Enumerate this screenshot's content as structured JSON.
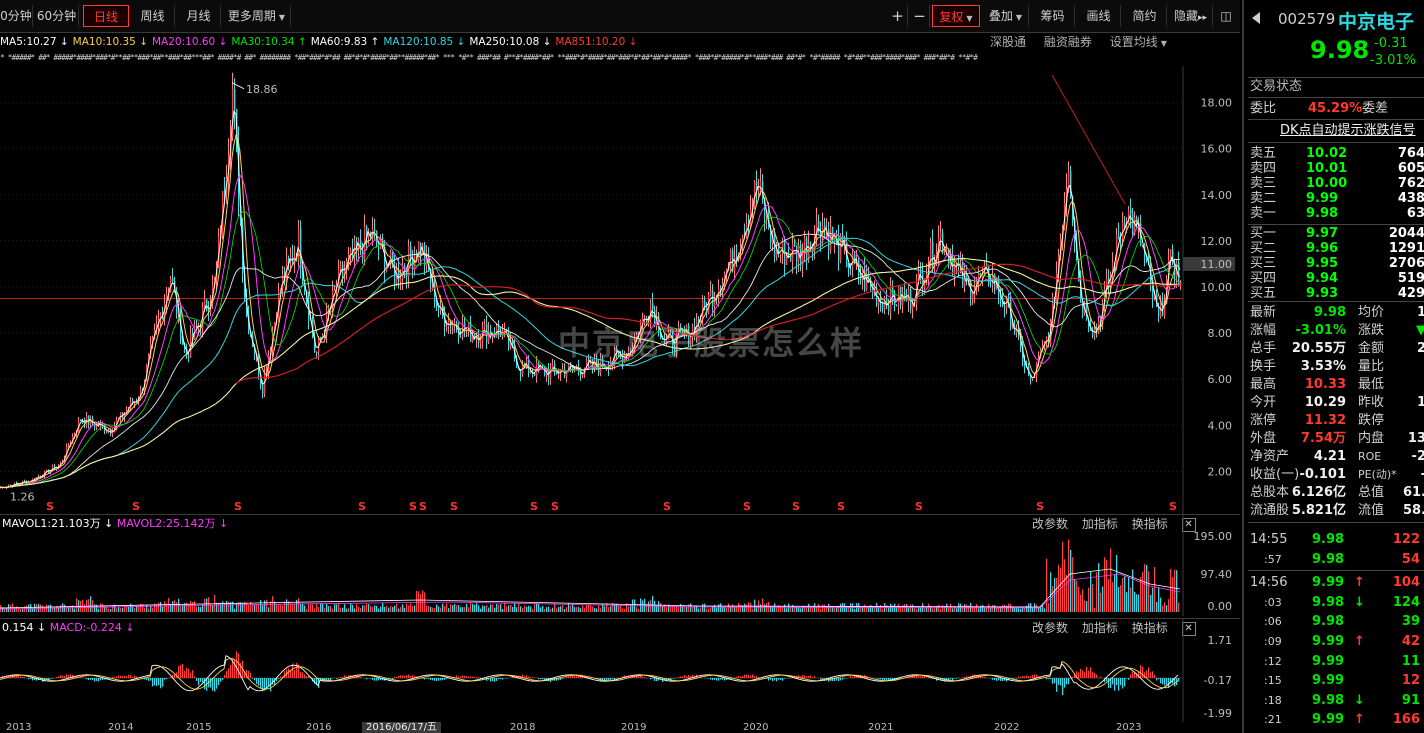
{
  "toolbar": {
    "tabs": [
      {
        "label": "0分钟",
        "active": false
      },
      {
        "label": "60分钟",
        "active": false
      },
      {
        "label": "日线",
        "active": true
      },
      {
        "label": "周线",
        "active": false
      },
      {
        "label": "月线",
        "active": false
      },
      {
        "label": "更多周期",
        "active": false,
        "dropdown": true
      }
    ],
    "zoom_in": "+",
    "zoom_out": "−",
    "fuquan": "复权",
    "overlay": "叠加",
    "chips": "筹码",
    "draw": "画线",
    "simple": "简约",
    "hide_indicators": "隐藏",
    "more": "▸▸",
    "expand": "◫"
  },
  "ma_legend": [
    {
      "label": "MA5:10.27",
      "arrow": "↓",
      "color": "#ffffff"
    },
    {
      "label": "MA10:10.35",
      "arrow": "↓",
      "color": "#ffd24a"
    },
    {
      "label": "MA20:10.60",
      "arrow": "↓",
      "color": "#ff3bff"
    },
    {
      "label": "MA30:10.34",
      "arrow": "↑",
      "color": "#00e600"
    },
    {
      "label": "MA60:9.83",
      "arrow": "↑",
      "color": "#ffffff"
    },
    {
      "label": "MA120:10.85",
      "arrow": "↓",
      "color": "#2fd8e0"
    },
    {
      "label": "MA250:10.08",
      "arrow": "↓",
      "color": "#ffffff"
    },
    {
      "label": "MA851:10.20",
      "arrow": "↓",
      "color": "#ff3b30"
    }
  ],
  "ma_tools": [
    "深股通",
    "融资融券",
    "设置均线"
  ],
  "star_row": "* *#####*  ##*  #####*####*###*#**##**###*##**###*##***##* ####*# ##*  ######## *##*###*#*##  ##*#*#*####*##**#####*##* *** *#** ###*##  #**#*####*##*  **###*#*####*##*###*#*##*##*#*####* *###*#*#####*#**###*###  ##*#* *#*#####  *#*##**###*####*###* ###*##*# **#*#",
  "price_axis": [
    "18.00",
    "16.00",
    "14.00",
    "12.00",
    "10.00",
    "8.00",
    "6.00",
    "4.00",
    "2.00"
  ],
  "current_price_tag": "11.00",
  "peak_label": "18.86",
  "low_label": "1.26",
  "signal_mark": "S",
  "watermark": "中京电子股票怎么样",
  "vol_pane": {
    "legend": [
      {
        "label": "MAVOL1:21.103万",
        "arrow": "↓",
        "color": "#ffffff"
      },
      {
        "label": "MAVOL2:25.142万",
        "arrow": "↓",
        "color": "#ff3bff"
      }
    ],
    "tools": [
      "改参数",
      "加指标",
      "换指标"
    ],
    "axis": [
      "195.00",
      "97.40",
      "0.00"
    ]
  },
  "macd_pane": {
    "legend": [
      {
        "label": "0.154",
        "arrow": "↓",
        "color": "#ffffff"
      },
      {
        "label": "MACD:-0.224",
        "arrow": "↓",
        "color": "#ff3bff"
      }
    ],
    "tools": [
      "改参数",
      "加指标",
      "换指标"
    ],
    "axis": [
      "1.71",
      "-0.17",
      "-1.99"
    ]
  },
  "date_axis": [
    "2013",
    "2014",
    "2015",
    "2016",
    "2018",
    "2019",
    "2020",
    "2021",
    "2022",
    "2023"
  ],
  "crosshair_date": "2016/06/17/五",
  "quote": {
    "code": "002579",
    "name": "中京电子",
    "price": "9.98",
    "change": "-0.31",
    "change_pct": "-3.01%",
    "trade_status_label": "交易状态",
    "weibi_label": "委比",
    "weibi_value": "45.29%",
    "weicha_label": "委差",
    "dk_signal": "DK点自动提示涨跌信号",
    "asks": [
      {
        "label": "卖五",
        "price": "10.02",
        "vol": "764"
      },
      {
        "label": "卖四",
        "price": "10.01",
        "vol": "605"
      },
      {
        "label": "卖三",
        "price": "10.00",
        "vol": "762"
      },
      {
        "label": "卖二",
        "price": "9.99",
        "vol": "438"
      },
      {
        "label": "卖一",
        "price": "9.98",
        "vol": "63"
      }
    ],
    "bids": [
      {
        "label": "买一",
        "price": "9.97",
        "vol": "2044"
      },
      {
        "label": "买二",
        "price": "9.96",
        "vol": "1291"
      },
      {
        "label": "买三",
        "price": "9.95",
        "vol": "2706"
      },
      {
        "label": "买四",
        "price": "9.94",
        "vol": "519"
      },
      {
        "label": "买五",
        "price": "9.93",
        "vol": "429"
      }
    ],
    "stats": [
      {
        "l1": "最新",
        "v1": "9.98",
        "c1": "green",
        "l2": "均价",
        "v2": "1"
      },
      {
        "l1": "涨幅",
        "v1": "-3.01%",
        "c1": "green",
        "l2": "涨跌",
        "v2": "▼"
      },
      {
        "l1": "总手",
        "v1": "20.55万",
        "c1": "white",
        "l2": "金额",
        "v2": "2"
      },
      {
        "l1": "换手",
        "v1": "3.53%",
        "c1": "white",
        "l2": "量比",
        "v2": ""
      },
      {
        "l1": "最高",
        "v1": "10.33",
        "c1": "red",
        "l2": "最低",
        "v2": ""
      },
      {
        "l1": "今开",
        "v1": "10.29",
        "c1": "white",
        "l2": "昨收",
        "v2": "1"
      },
      {
        "l1": "涨停",
        "v1": "11.32",
        "c1": "red",
        "l2": "跌停",
        "v2": ""
      },
      {
        "l1": "外盘",
        "v1": "7.54万",
        "c1": "red",
        "l2": "内盘",
        "v2": "13"
      },
      {
        "l1": "净资产",
        "v1": "4.21",
        "c1": "white",
        "l2": "ROE",
        "v2": "-2"
      },
      {
        "l1": "收益(一)",
        "v1": "-0.101",
        "c1": "white",
        "l2": "PE(动)*",
        "v2": "-"
      },
      {
        "l1": "总股本",
        "v1": "6.126亿",
        "c1": "white",
        "l2": "总值",
        "v2": "61."
      },
      {
        "l1": "流通股",
        "v1": "5.821亿",
        "c1": "white",
        "l2": "流值",
        "v2": "58."
      }
    ],
    "ticks": [
      {
        "time": "14:55",
        "price": "9.98",
        "arrow": "",
        "vol": "122",
        "vcolor": "red"
      },
      {
        "time": ":57",
        "price": "9.98",
        "arrow": "",
        "vol": "54",
        "vcolor": "red"
      },
      {
        "time": "14:56",
        "price": "9.99",
        "arrow": "↑",
        "vol": "104",
        "vcolor": "red"
      },
      {
        "time": ":03",
        "price": "9.98",
        "arrow": "↓",
        "vol": "124",
        "vcolor": "green"
      },
      {
        "time": ":06",
        "price": "9.98",
        "arrow": "",
        "vol": "39",
        "vcolor": "green"
      },
      {
        "time": ":09",
        "price": "9.99",
        "arrow": "↑",
        "vol": "42",
        "vcolor": "red"
      },
      {
        "time": ":12",
        "price": "9.99",
        "arrow": "",
        "vol": "11",
        "vcolor": "green"
      },
      {
        "time": ":15",
        "price": "9.99",
        "arrow": "",
        "vol": "12",
        "vcolor": "red"
      },
      {
        "time": ":18",
        "price": "9.98",
        "arrow": "↓",
        "vol": "91",
        "vcolor": "green"
      },
      {
        "time": ":21",
        "price": "9.99",
        "arrow": "↑",
        "vol": "166",
        "vcolor": "red"
      }
    ]
  },
  "chart_data": {
    "type": "line",
    "title": "",
    "x": [
      "2013",
      "2014",
      "2015",
      "2016",
      "2018",
      "2019",
      "2020",
      "2021",
      "2022",
      "2023"
    ],
    "ylim": [
      0.5,
      19.5
    ],
    "series": [
      {
        "name": "MA5",
        "values": [
          1.3,
          4.2,
          16.5,
          9.8,
          6.6,
          8.4,
          13.8,
          10.5,
          6.0,
          10.27
        ]
      },
      {
        "name": "MA250",
        "values": [
          null,
          null,
          4.3,
          8.0,
          8.6,
          8.9,
          9.6,
          9.7,
          9.8,
          10.08
        ]
      }
    ],
    "price_close": [
      1.3,
      4.2,
      16.5,
      9.8,
      6.6,
      8.4,
      13.8,
      10.5,
      6.0,
      9.98
    ],
    "reference_price": 9.5
  }
}
